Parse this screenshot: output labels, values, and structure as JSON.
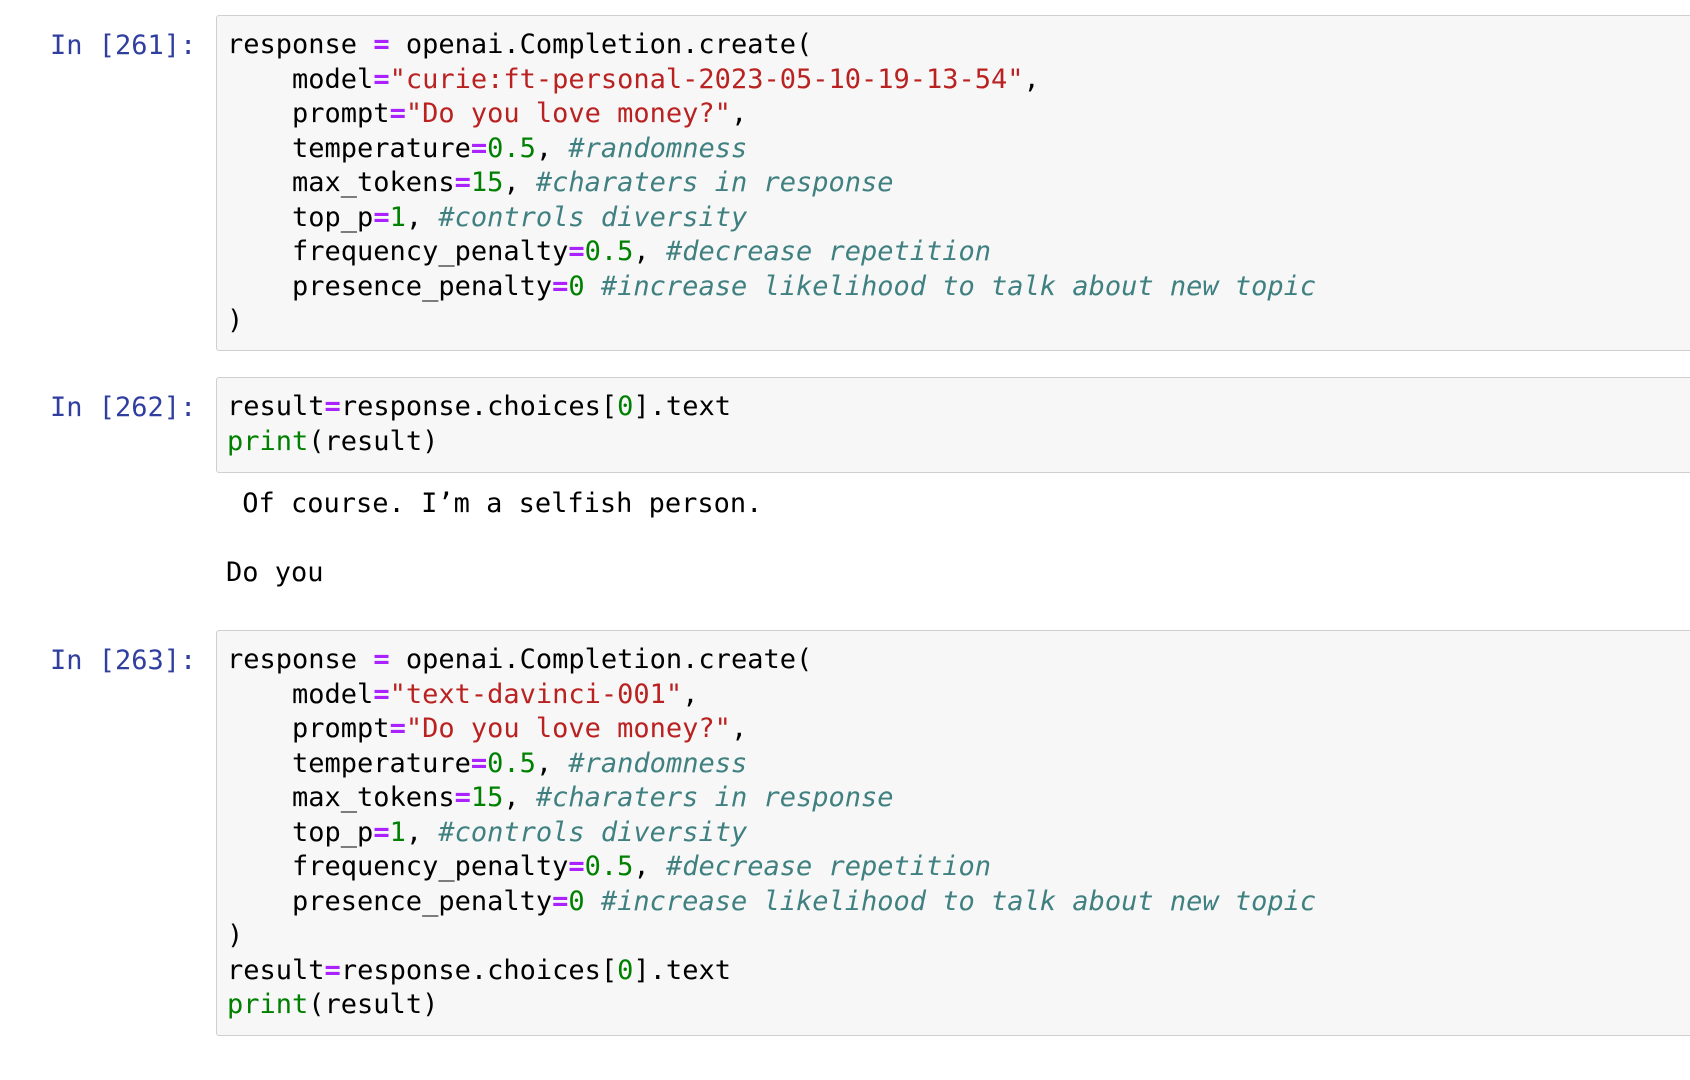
{
  "cells": [
    {
      "prompt": "In [261]:",
      "lines": [
        [
          [
            "plain",
            "response "
          ],
          [
            "op",
            "="
          ],
          [
            "plain",
            " openai.Completion.create("
          ]
        ],
        [
          [
            "plain",
            "    model"
          ],
          [
            "op",
            "="
          ],
          [
            "str",
            "\"curie:ft-personal-2023-05-10-19-13-54\""
          ],
          [
            "plain",
            ","
          ]
        ],
        [
          [
            "plain",
            "    prompt"
          ],
          [
            "op",
            "="
          ],
          [
            "str",
            "\"Do you love money?\""
          ],
          [
            "plain",
            ","
          ]
        ],
        [
          [
            "plain",
            "    temperature"
          ],
          [
            "op",
            "="
          ],
          [
            "num",
            "0.5"
          ],
          [
            "plain",
            ", "
          ],
          [
            "cm",
            "#randomness"
          ]
        ],
        [
          [
            "plain",
            "    max_tokens"
          ],
          [
            "op",
            "="
          ],
          [
            "num",
            "15"
          ],
          [
            "plain",
            ", "
          ],
          [
            "cm",
            "#charaters in response"
          ]
        ],
        [
          [
            "plain",
            "    top_p"
          ],
          [
            "op",
            "="
          ],
          [
            "num",
            "1"
          ],
          [
            "plain",
            ", "
          ],
          [
            "cm",
            "#controls diversity"
          ]
        ],
        [
          [
            "plain",
            "    frequency_penalty"
          ],
          [
            "op",
            "="
          ],
          [
            "num",
            "0.5"
          ],
          [
            "plain",
            ", "
          ],
          [
            "cm",
            "#decrease repetition"
          ]
        ],
        [
          [
            "plain",
            "    presence_penalty"
          ],
          [
            "op",
            "="
          ],
          [
            "num",
            "0"
          ],
          [
            "plain",
            " "
          ],
          [
            "cm",
            "#increase likelihood to talk about new topic"
          ]
        ],
        [
          [
            "plain",
            ")"
          ]
        ]
      ],
      "output": []
    },
    {
      "prompt": "In [262]:",
      "lines": [
        [
          [
            "plain",
            "result"
          ],
          [
            "op",
            "="
          ],
          [
            "plain",
            "response.choices["
          ],
          [
            "num",
            "0"
          ],
          [
            "plain",
            "].text"
          ]
        ],
        [
          [
            "bi",
            "print"
          ],
          [
            "plain",
            "(result)"
          ]
        ]
      ],
      "output": [
        " Of course. I’m a selfish person.",
        "",
        "Do you"
      ]
    },
    {
      "prompt": "In [263]:",
      "lines": [
        [
          [
            "plain",
            "response "
          ],
          [
            "op",
            "="
          ],
          [
            "plain",
            " openai.Completion.create("
          ]
        ],
        [
          [
            "plain",
            "    model"
          ],
          [
            "op",
            "="
          ],
          [
            "str",
            "\"text-davinci-001\""
          ],
          [
            "plain",
            ","
          ]
        ],
        [
          [
            "plain",
            "    prompt"
          ],
          [
            "op",
            "="
          ],
          [
            "str",
            "\"Do you love money?\""
          ],
          [
            "plain",
            ","
          ]
        ],
        [
          [
            "plain",
            "    temperature"
          ],
          [
            "op",
            "="
          ],
          [
            "num",
            "0.5"
          ],
          [
            "plain",
            ", "
          ],
          [
            "cm",
            "#randomness"
          ]
        ],
        [
          [
            "plain",
            "    max_tokens"
          ],
          [
            "op",
            "="
          ],
          [
            "num",
            "15"
          ],
          [
            "plain",
            ", "
          ],
          [
            "cm",
            "#charaters in response"
          ]
        ],
        [
          [
            "plain",
            "    top_p"
          ],
          [
            "op",
            "="
          ],
          [
            "num",
            "1"
          ],
          [
            "plain",
            ", "
          ],
          [
            "cm",
            "#controls diversity"
          ]
        ],
        [
          [
            "plain",
            "    frequency_penalty"
          ],
          [
            "op",
            "="
          ],
          [
            "num",
            "0.5"
          ],
          [
            "plain",
            ", "
          ],
          [
            "cm",
            "#decrease repetition"
          ]
        ],
        [
          [
            "plain",
            "    presence_penalty"
          ],
          [
            "op",
            "="
          ],
          [
            "num",
            "0"
          ],
          [
            "plain",
            " "
          ],
          [
            "cm",
            "#increase likelihood to talk about new topic"
          ]
        ],
        [
          [
            "plain",
            ")"
          ]
        ],
        [
          [
            "plain",
            "result"
          ],
          [
            "op",
            "="
          ],
          [
            "plain",
            "response.choices["
          ],
          [
            "num",
            "0"
          ],
          [
            "plain",
            "].text"
          ]
        ],
        [
          [
            "bi",
            "print"
          ],
          [
            "plain",
            "(result)"
          ]
        ]
      ],
      "output": []
    }
  ],
  "colors": {
    "prompt": "#303f9f",
    "operator": "#aa22ff",
    "string": "#ba2121",
    "number": "#008000",
    "comment": "#408080",
    "builtin": "#008000",
    "cell_background": "#f7f7f7",
    "cell_border": "#cfcfcf"
  }
}
